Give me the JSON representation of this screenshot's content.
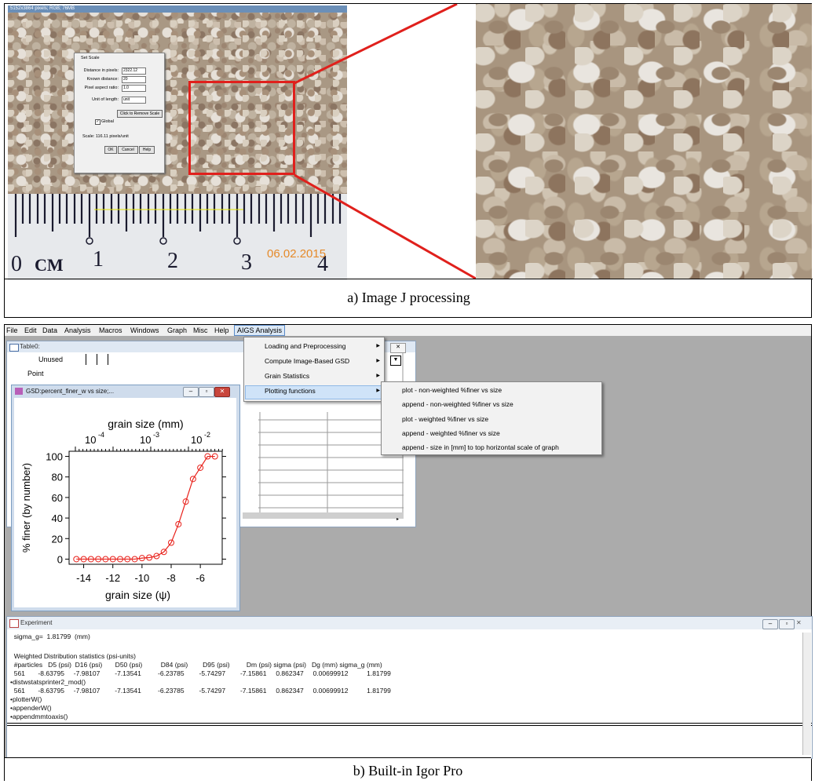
{
  "panel_a": {
    "imagej_title": "5152x3864 pixels; RGB; 76MB",
    "set_scale_dialog": {
      "title": "Set Scale",
      "fields": [
        {
          "label": "Distance in pixels:",
          "value": "2322.12"
        },
        {
          "label": "Known distance:",
          "value": "20"
        },
        {
          "label": "Pixel aspect ratio:",
          "value": "1.0"
        },
        {
          "label": "Unit of length:",
          "value": "unit"
        }
      ],
      "remove_scale_button": "Click to Remove Scale",
      "global_checkbox": {
        "label": "Global",
        "checked": true
      },
      "scale_text": "Scale: 116.11 pixels/unit",
      "ok_button": "OK",
      "cancel_button": "Cancel",
      "help_button": "Help"
    },
    "ruler": {
      "unit": "CM",
      "numbers": [
        "0",
        "1",
        "2",
        "3",
        "4"
      ],
      "date_stamp": "06.02.2015"
    },
    "caption": "a) Image J processing",
    "highlight_color": "#e0201c"
  },
  "panel_b": {
    "menubar": [
      "File",
      "Edit",
      "Data",
      "Analysis",
      "Macros",
      "Windows",
      "Graph",
      "Misc",
      "Help",
      "AIGS Analysis"
    ],
    "aigs_menu": [
      "Loading and Preprocessing",
      "Compute Image-Based GSD",
      "Grain Statistics",
      "Plotting functions"
    ],
    "plotting_submenu": [
      "plot - non-weighted %finer vs size",
      "append - non-weighted %finer vs size",
      "plot - weighted %finer vs size",
      "append - weighted %finer vs size",
      "append - size in [mm] to top horizontal scale of graph"
    ],
    "table_window": {
      "title": "Table0:",
      "rows": [
        "Unused",
        "Point"
      ]
    },
    "graph_window": {
      "title": "GSD:percent_finer_w vs size;..."
    },
    "experiment_window": {
      "title": "Experiment",
      "lines": [
        "  sigma_g=  1.81799  (mm)",
        "",
        "  Weighted Distribution statistics (psi-units)",
        "  #particles   D5 (psi)  D16 (psi)       D50 (psi)          D84 (psi)        D95 (psi)         Dm (psi) sigma (psi)   Dg (mm) sigma_g (mm)",
        "  561       -8.63795     -7.98107        -7.13541         -6.23785        -5.74297        -7.15861     0.862347     0.00699912          1.81799",
        "•distwstatsprinter2_mod()",
        "  561       -8.63795     -7.98107        -7.13541         -6.23785        -5.74297        -7.15861     0.862347     0.00699912          1.81799",
        "•plotterW()",
        "•appenderW()",
        "•appendmmtoaxis()"
      ]
    },
    "caption": "b) Built-in Igor Pro"
  },
  "chart_data": {
    "type": "line",
    "xlabel": "grain size (ψ)",
    "ylabel": "% finer (by number)",
    "top_axis_label": "grain size (mm)",
    "top_axis_ticks": [
      "10^-4",
      "10^-3",
      "10^-2"
    ],
    "x_ticks": [
      -14,
      -12,
      -10,
      -8,
      -6
    ],
    "y_ticks": [
      0,
      20,
      40,
      60,
      80,
      100
    ],
    "xlim": [
      -15,
      -4.5
    ],
    "ylim": [
      -5,
      105
    ],
    "series": [
      {
        "color": "#e8201a",
        "marker": "open-circle",
        "x": [
          -14.5,
          -14,
          -13.5,
          -13,
          -12.5,
          -12,
          -11.5,
          -11,
          -10.5,
          -10,
          -9.5,
          -9,
          -8.5,
          -8,
          -7.5,
          -7,
          -6.5,
          -6,
          -5.5,
          -5
        ],
        "y": [
          0,
          0,
          0,
          0,
          0,
          0,
          0,
          0,
          0,
          1,
          1.5,
          3,
          7,
          16,
          34,
          56,
          78,
          89,
          100,
          100
        ]
      }
    ]
  }
}
